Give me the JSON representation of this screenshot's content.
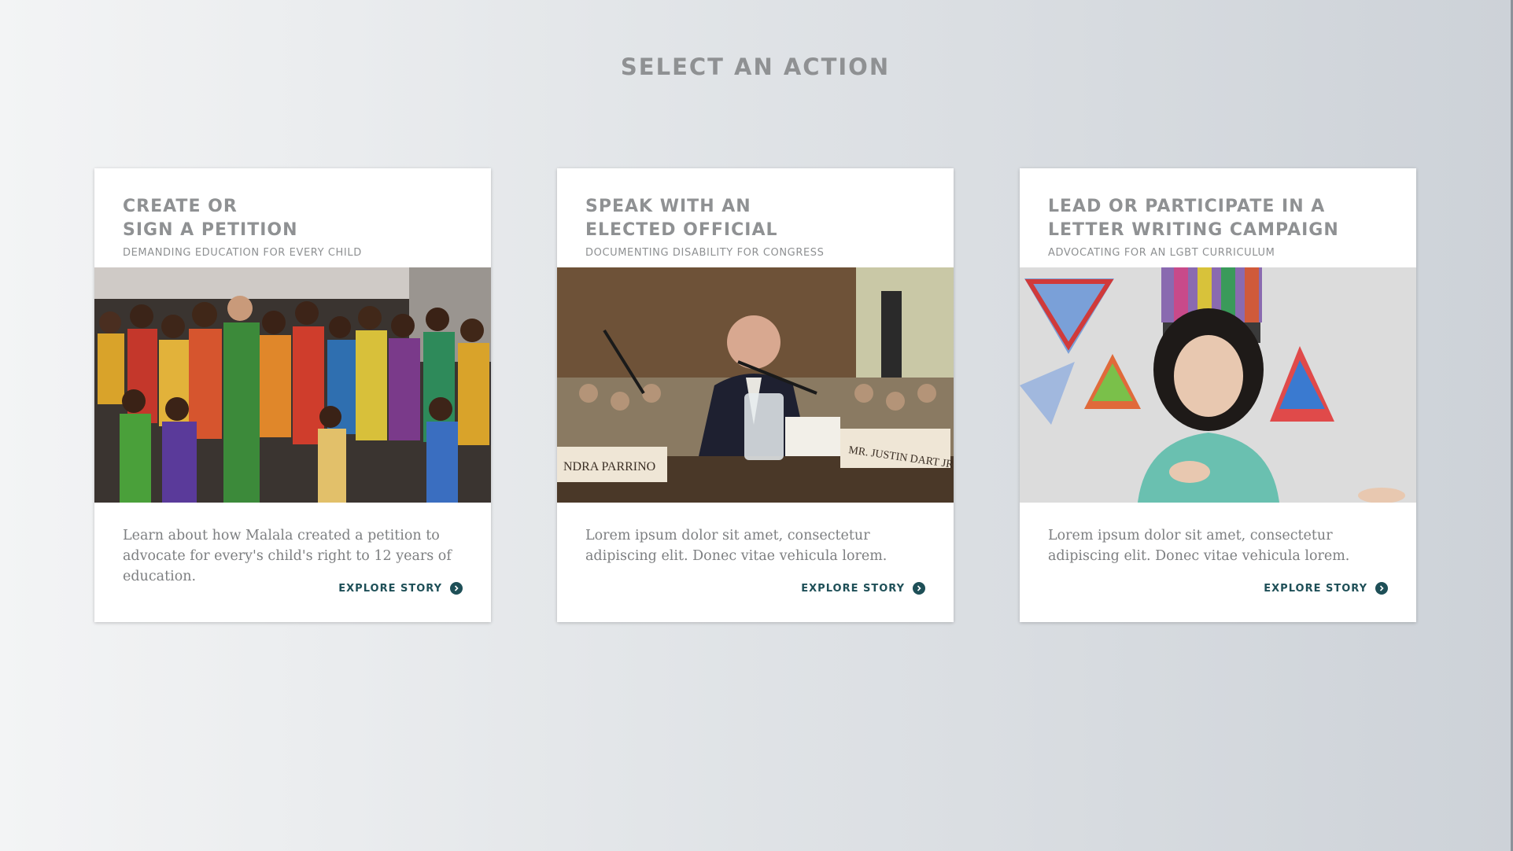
{
  "page": {
    "title": "SELECT AN ACTION"
  },
  "colors": {
    "title": "#8f9193",
    "accent": "#1e4f57",
    "card_bg": "#ffffff"
  },
  "cards": [
    {
      "title": "CREATE OR\nSIGN A PETITION",
      "subtitle": "DEMANDING EDUCATION FOR EVERY CHILD",
      "photo": "crowd-of-children-in-colorful-clothing-photo",
      "description": "Learn about how Malala created a petition to advocate for every's child's right to 12 years of education.",
      "link_label": "EXPLORE STORY",
      "link_icon": "chevron-right-circle-icon"
    },
    {
      "title": "SPEAK WITH AN\nELECTED OFFICIAL",
      "subtitle": "DOCUMENTING DISABILITY FOR CONGRESS",
      "photo": "man-testifying-at-hearing-photo",
      "name_plates": [
        "NDRA PARRINO",
        "MR.\nJUSTIN DART JR"
      ],
      "description": "Lorem ipsum dolor sit amet, consectetur adipiscing elit. Donec vitae vehicula lorem.",
      "link_label": "EXPLORE STORY",
      "link_icon": "chevron-right-circle-icon"
    },
    {
      "title": "LEAD OR PARTICIPATE IN A\nLETTER WRITING CAMPAIGN",
      "subtitle": "ADVOCATING FOR AN LGBT CURRICULUM",
      "photo": "girl-in-front-of-rainbow-drawings-photo",
      "description": "Lorem ipsum dolor sit amet, consectetur adipiscing elit. Donec vitae vehicula lorem.",
      "link_label": "EXPLORE STORY",
      "link_icon": "chevron-right-circle-icon"
    }
  ]
}
